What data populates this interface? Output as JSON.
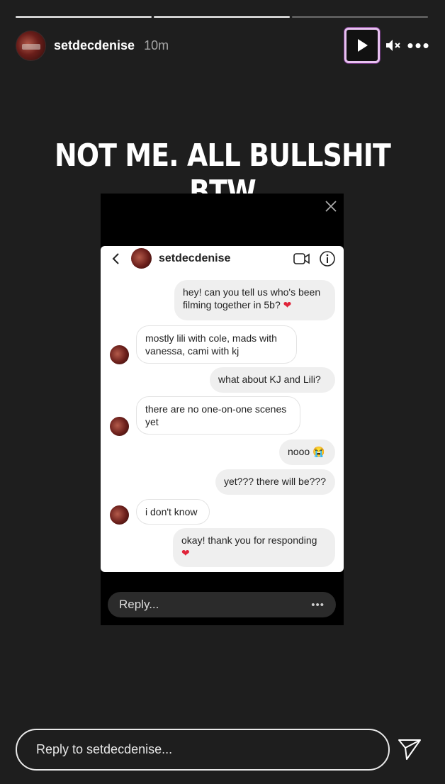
{
  "story": {
    "username": "setdecdenise",
    "time": "10m",
    "progress_segments": [
      1,
      1,
      0
    ],
    "caption": "NOT ME.  ALL BULLSHIT BTW"
  },
  "controls": {
    "play_icon": "play-icon",
    "mute_icon": "muted-speaker-icon",
    "more_label": "•••"
  },
  "screenshot": {
    "dm_username": "setdecdenise",
    "messages": [
      {
        "from": "me",
        "line1": "hey! can you tell us who's been",
        "line2": "filming together in 5b?",
        "heart": "❤"
      },
      {
        "from": "them",
        "line1": "mostly lili with cole, mads with",
        "line2": "vanessa, cami with kj"
      },
      {
        "from": "me",
        "line1": "what about KJ and Lili?"
      },
      {
        "from": "them",
        "line1": "there are no one-on-one scenes",
        "line2": "yet"
      },
      {
        "from": "me",
        "line1": "nooo",
        "emoji": "😭"
      },
      {
        "from": "me",
        "line1": "yet??? there will be???"
      },
      {
        "from": "them",
        "line1": "i don't know"
      },
      {
        "from": "me",
        "line1": "okay! thank you for responding",
        "heart": "❤"
      }
    ],
    "reply_label": "Reply...",
    "reply_more": "•••"
  },
  "reply": {
    "placeholder": "Reply to setdecdenise..."
  },
  "colors": {
    "background": "#1e1e1e",
    "play_highlight": "#e7c1f0",
    "heart": "#e0243a"
  }
}
